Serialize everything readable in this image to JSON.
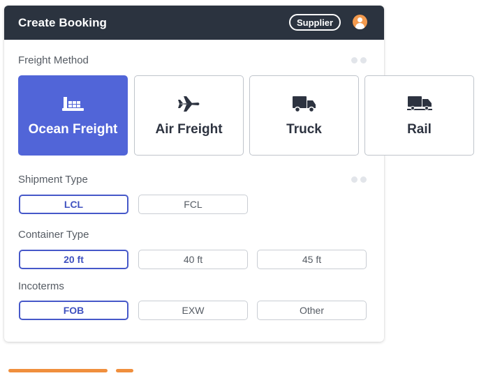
{
  "header": {
    "title": "Create Booking",
    "badge": "Supplier",
    "avatar_icon": "user-avatar-icon"
  },
  "freight_method": {
    "label": "Freight Method",
    "options": [
      {
        "label": "Ocean Freight",
        "icon": "ship-container-icon",
        "selected": true
      },
      {
        "label": "Air Freight",
        "icon": "airplane-icon",
        "selected": false
      },
      {
        "label": "Truck",
        "icon": "truck-icon",
        "selected": false
      },
      {
        "label": "Rail",
        "icon": "rail-icon",
        "selected": false
      }
    ]
  },
  "shipment_type": {
    "label": "Shipment Type",
    "options": [
      {
        "label": "LCL",
        "selected": true
      },
      {
        "label": "FCL",
        "selected": false
      }
    ]
  },
  "container_type": {
    "label": "Container Type",
    "options": [
      {
        "label": "20 ft",
        "selected": true
      },
      {
        "label": "40 ft",
        "selected": false
      },
      {
        "label": "45 ft",
        "selected": false
      }
    ]
  },
  "incoterms": {
    "label": "Incoterms",
    "options": [
      {
        "label": "FOB",
        "selected": true
      },
      {
        "label": "EXW",
        "selected": false
      },
      {
        "label": "Other",
        "selected": false
      }
    ]
  },
  "colors": {
    "header_bg": "#2b333f",
    "accent": "#5165d8",
    "selected_border": "#4658c9",
    "progress": "#f08f3d",
    "avatar": "#f39a4e"
  }
}
